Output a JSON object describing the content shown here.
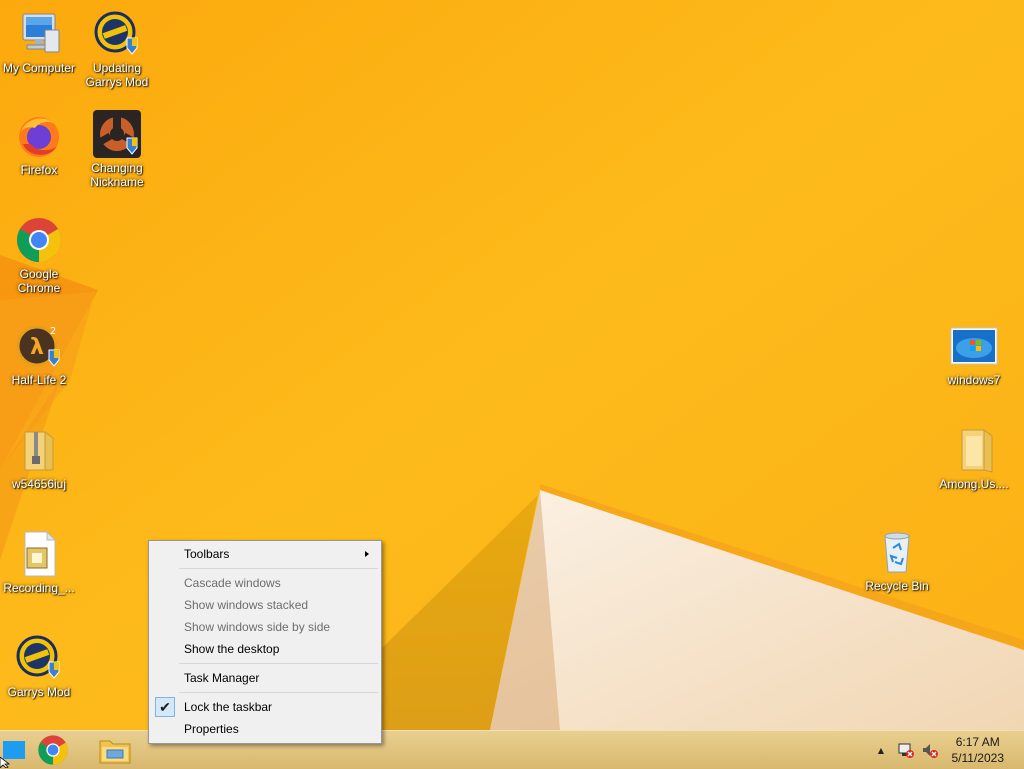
{
  "desktop": {
    "icons_left": [
      {
        "label": "My Computer",
        "icon": "computer-icon"
      },
      {
        "label": "Updating\nGarrys Mod",
        "icon": "garrysmod-icon"
      },
      {
        "label": "Firefox",
        "icon": "firefox-icon"
      },
      {
        "label": "Changing\nNickname",
        "icon": "tf2-icon"
      },
      {
        "label": "Google\nChrome",
        "icon": "chrome-icon"
      },
      {
        "label": "Half-Life 2",
        "icon": "halflife2-icon"
      },
      {
        "label": "w54656iuj",
        "icon": "zip-folder-icon"
      },
      {
        "label": "Recording_...",
        "icon": "recording-file-icon"
      },
      {
        "label": "Garrys Mod",
        "icon": "garrysmod-icon"
      }
    ],
    "icons_right": [
      {
        "label": "windows7",
        "icon": "windows7-image-icon"
      },
      {
        "label": "Among.Us....",
        "icon": "folder-icon"
      },
      {
        "label": "Recycle Bin",
        "icon": "recycle-bin-icon"
      }
    ]
  },
  "context_menu": {
    "items": [
      {
        "label": "Toolbars",
        "submenu": true
      },
      {
        "label": "Cascade windows",
        "disabled": true
      },
      {
        "label": "Show windows stacked",
        "disabled": true
      },
      {
        "label": "Show windows side by side",
        "disabled": true
      },
      {
        "label": "Show the desktop"
      },
      {
        "label": "Task Manager"
      },
      {
        "label": "Lock the taskbar",
        "checked": true,
        "check_glyph": "✔"
      },
      {
        "label": "Properties"
      }
    ]
  },
  "taskbar": {
    "pinned": [
      "start-button",
      "chrome-icon",
      "file-explorer-icon"
    ],
    "tray": {
      "chevron_glyph": "▲",
      "icons": [
        "network-disconnected-icon",
        "speaker-muted-icon"
      ]
    },
    "clock": {
      "time": "6:17 AM",
      "date": "5/11/2023"
    }
  },
  "colors": {
    "wallpaper": "#fbb212",
    "taskbar": "#e0c27a",
    "menu_bg": "#f0f0f0",
    "check_bg": "#d5e8f7"
  }
}
